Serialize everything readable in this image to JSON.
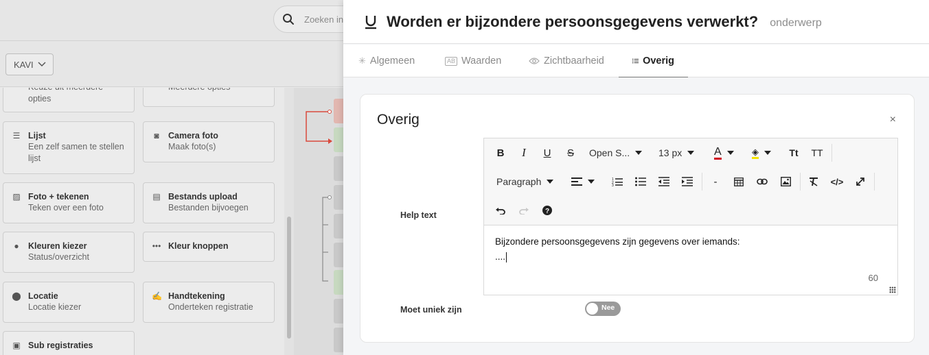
{
  "background": {
    "search": {
      "placeholder": "Zoeken in"
    },
    "filter_button": {
      "label": "KAVI"
    },
    "palette": [
      {
        "title": "",
        "subtitle": "Keuze uit meerdere opties",
        "icon": "list-choice-icon"
      },
      {
        "title": "",
        "subtitle": "Meerdere opties",
        "icon": "list-choice-icon"
      },
      {
        "title": "Lijst",
        "subtitle": "Een zelf samen te stellen lijst",
        "icon": "list-icon"
      },
      {
        "title": "Camera foto",
        "subtitle": "Maak foto(s)",
        "icon": "camera-icon"
      },
      {
        "title": "Foto + tekenen",
        "subtitle": "Teken over een foto",
        "icon": "image-icon"
      },
      {
        "title": "Bestands upload",
        "subtitle": "Bestanden bijvoegen",
        "icon": "images-icon"
      },
      {
        "title": "Kleuren kiezer",
        "subtitle": "Status/overzicht",
        "icon": "droplet-icon"
      },
      {
        "title": "Kleur knoppen",
        "subtitle": "",
        "icon": "dots-icon"
      },
      {
        "title": "Locatie",
        "subtitle": "Locatie kiezer",
        "icon": "map-pin-icon"
      },
      {
        "title": "Handtekening",
        "subtitle": "Onderteken registratie",
        "icon": "signature-icon"
      },
      {
        "title": "Sub registraties",
        "subtitle": "",
        "icon": "clipboard-icon"
      }
    ]
  },
  "panel": {
    "header": {
      "type_icon": "underline-icon",
      "title": "Worden er bijzondere persoonsgegevens verwerkt?",
      "subtitle": "onderwerp"
    },
    "tabs": [
      {
        "label": "Algemeen",
        "icon": "asterisk-icon",
        "active": false
      },
      {
        "label": "Waarden",
        "icon": "tag-icon",
        "active": false
      },
      {
        "label": "Zichtbaarheid",
        "icon": "eye-icon",
        "active": false
      },
      {
        "label": "Overig",
        "icon": "list-icon",
        "active": true
      }
    ],
    "card": {
      "title": "Overig",
      "close_label": "×",
      "help_text_label": "Help text",
      "editor": {
        "font_family": "Open S...",
        "font_size": "13 px",
        "block_format": "Paragraph",
        "hr_label": "-",
        "content_line1": "Bijzondere persoonsgegevens zijn gegevens over iemands:",
        "content_line2": "....",
        "word_count": "60",
        "text_color": "#d0021b",
        "highlight_color": "#f5e400"
      },
      "unique_label": "Moet uniek zijn",
      "unique_toggle": {
        "label": "Nee",
        "on": false
      }
    }
  }
}
